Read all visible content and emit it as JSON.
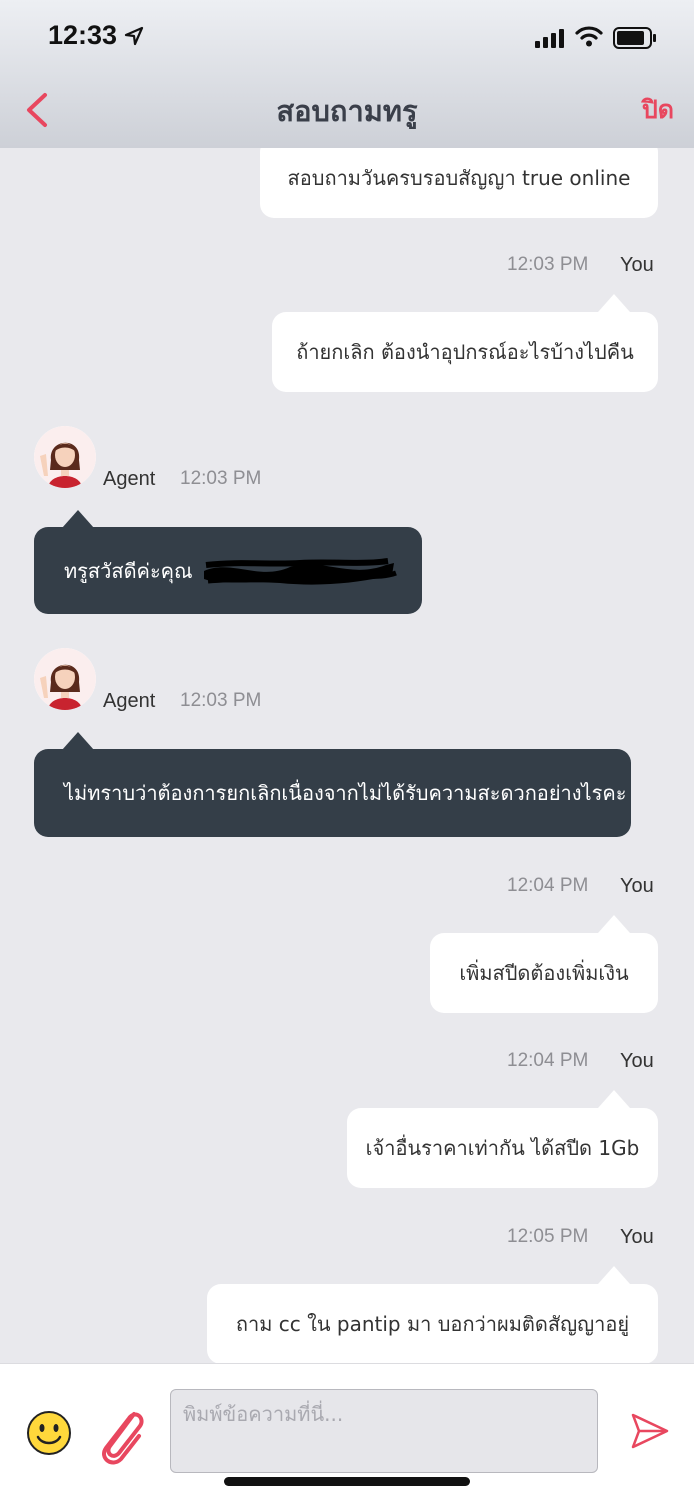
{
  "status_bar": {
    "time": "12:33"
  },
  "header": {
    "title": "สอบถามทรู",
    "close_label": "ปิด"
  },
  "messages": [
    {
      "sender": "You",
      "text": "สอบถามวันครบรอบสัญญา true online"
    },
    {
      "sender": "You",
      "sender_label": "You",
      "time": "12:03 PM",
      "text": "ถ้ายกเลิก ต้องนำอุปกรณ์อะไรบ้างไปคืน"
    },
    {
      "sender": "Agent",
      "sender_label": "Agent",
      "time": "12:03 PM",
      "text": "ทรูสวัสดีค่ะคุณ"
    },
    {
      "sender": "Agent",
      "sender_label": "Agent",
      "time": "12:03 PM",
      "text": "ไม่ทราบว่าต้องการยกเลิกเนื่องจากไม่ได้รับความสะดวกอย่างไรคะ"
    },
    {
      "sender": "You",
      "sender_label": "You",
      "time": "12:04 PM",
      "text": "เพิ่มสปีดต้องเพิ่มเงิน"
    },
    {
      "sender": "You",
      "sender_label": "You",
      "time": "12:04 PM",
      "text": "เจ้าอื่นราคาเท่ากัน ได้สปีด 1Gb"
    },
    {
      "sender": "You",
      "sender_label": "You",
      "time": "12:05 PM",
      "text": "ถาม cc ใน pantip มา บอกว่าผมติดสัญญาอยู่"
    }
  ],
  "composer": {
    "placeholder": "พิมพ์ข้อความที่นี่..."
  },
  "colors": {
    "accent": "#e8475f",
    "agent_bubble": "#343e48",
    "user_bubble": "#ffffff",
    "background": "#e9e9ed"
  }
}
